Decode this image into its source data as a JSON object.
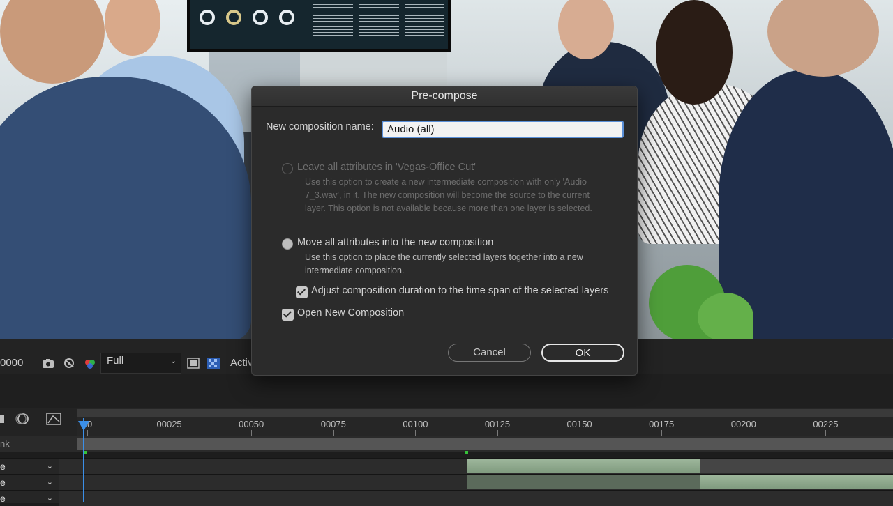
{
  "dialog": {
    "title": "Pre-compose",
    "name_label": "New composition name:",
    "name_value": "Audio (all)",
    "option_leave": {
      "label": "Leave all attributes in 'Vegas-Office Cut'",
      "desc_lines": [
        "Use this option to create a new intermediate composition with only 'Audio",
        "7_3.wav', in it. The new composition will become the source to the current",
        "layer. This option is not available because more than one layer is selected."
      ]
    },
    "option_move": {
      "label": "Move all attributes into the new composition",
      "desc_lines": [
        "Use this option to place the currently selected layers together into a new",
        "intermediate composition."
      ]
    },
    "adjust_duration_label": "Adjust composition duration to the time span of the selected layers",
    "open_new_label": "Open New Composition",
    "cancel_label": "Cancel",
    "ok_label": "OK"
  },
  "viewer": {
    "timecode": "0000",
    "resolution": "Full",
    "active_camera_partial": "Activ"
  },
  "timeline": {
    "ruler_labels": [
      "00",
      "00025",
      "00050",
      "00075",
      "00100",
      "00125",
      "00150",
      "00175",
      "00200",
      "00225"
    ],
    "work_row_label": "nk",
    "layers": [
      {
        "label": "e"
      },
      {
        "label": "e"
      },
      {
        "label": "e"
      }
    ]
  },
  "colors": {
    "playhead": "#3b8fe8",
    "audio_clip": "#8fa88e",
    "input_focus": "#5b90d8"
  }
}
